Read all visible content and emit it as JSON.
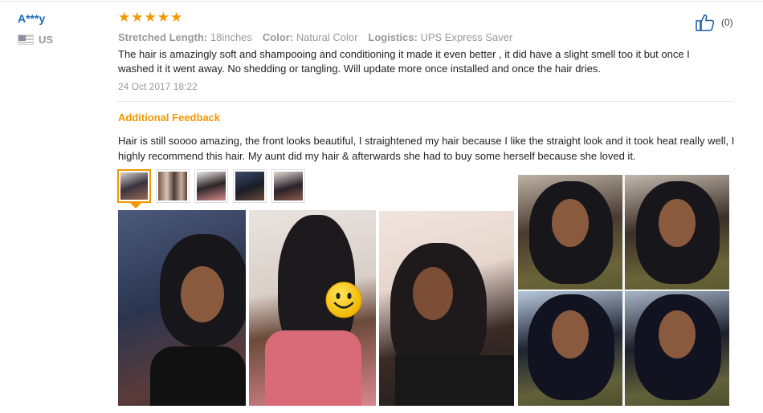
{
  "reviewer": {
    "name": "A***y",
    "country": "US",
    "flag_icon": "us-flag-icon"
  },
  "rating": {
    "stars": 5,
    "max": 5,
    "star_glyph": "★",
    "color": "#f39800"
  },
  "helpful": {
    "icon": "thumbs-up-icon",
    "count": "(0)"
  },
  "attributes": [
    {
      "key": "Stretched Length:",
      "value": "18inches"
    },
    {
      "key": "Color:",
      "value": "Natural Color"
    },
    {
      "key": "Logistics:",
      "value": "UPS Express Saver"
    }
  ],
  "review": {
    "text": "The hair is amazingly soft and shampooing and conditioning it made it even better , it did have a slight smell too it but once I washed it it went away. No shedding or tangling. Will update more once installed and once the hair dries.",
    "date": "24 Oct 2017 18:22"
  },
  "additional": {
    "title": "Additional Feedback",
    "text": "Hair is still soooo amazing, the front looks beautiful, I straightened my hair because I like the straight look and it took heat really well, I highly recommend this hair. My aunt did my hair & afterwards she had to buy some herself because she loved it."
  },
  "thumbnails": {
    "count": 5,
    "selected": 1
  },
  "colors": {
    "accent": "#f39800",
    "link": "#1a6ab8",
    "muted": "#999999"
  }
}
